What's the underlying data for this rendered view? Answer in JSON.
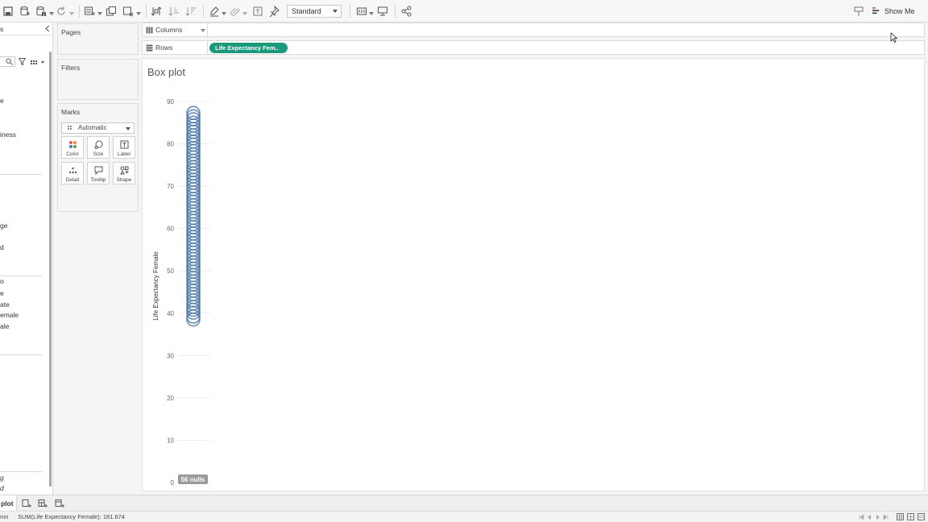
{
  "toolbar": {
    "fit_value": "Standard",
    "show_me_label": "Show Me",
    "icons": [
      "save-icon",
      "new-data-source-icon",
      "pause-icon",
      "refresh-icon",
      "new-worksheet-icon",
      "duplicate-icon",
      "clear-icon",
      "swap-icon",
      "sort-ascending-icon",
      "sort-descending-icon",
      "highlight-icon",
      "group-icon",
      "labels-icon",
      "pin-icon",
      "fit-icon",
      "presentation-icon",
      "share-icon"
    ]
  },
  "data_pane": {
    "header_fragment": "s",
    "field_fragments": [
      "e",
      "iness",
      "ge",
      "d",
      "o",
      "e",
      "ate",
      "emale",
      "ale"
    ],
    "bottom_fragments": [
      "g",
      "d"
    ]
  },
  "cards": {
    "pages_title": "Pages",
    "filters_title": "Filters",
    "marks_title": "Marks",
    "mark_type": "Automatic",
    "mark_buttons": [
      "Color",
      "Size",
      "Label",
      "Detail",
      "Tooltip",
      "Shape"
    ]
  },
  "shelves": {
    "columns_label": "Columns",
    "rows_label": "Rows",
    "rows_pill": "Life Expectancy Fem.."
  },
  "view": {
    "sheet_title": "Box plot"
  },
  "chart_data": {
    "type": "scatter",
    "ylabel": "Life Expectancy Female",
    "ylim": [
      0,
      90
    ],
    "yticks": [
      0,
      10,
      20,
      30,
      40,
      50,
      60,
      70,
      80,
      90
    ],
    "mark_color": "#4e79a7",
    "null_indicator": "56 nulls",
    "y_values": [
      38.5,
      39.2,
      40.1,
      40.8,
      41.5,
      42.3,
      43.0,
      43.8,
      44.5,
      45.3,
      46.0,
      46.8,
      47.5,
      48.3,
      49.0,
      49.8,
      50.5,
      51.3,
      52.0,
      52.8,
      53.5,
      54.3,
      55.0,
      55.8,
      56.5,
      57.3,
      58.0,
      58.8,
      59.5,
      60.3,
      61.0,
      61.8,
      62.5,
      63.3,
      64.0,
      64.8,
      65.5,
      66.3,
      67.0,
      67.8,
      68.5,
      69.3,
      70.0,
      70.8,
      71.5,
      72.3,
      73.0,
      73.8,
      74.5,
      75.3,
      76.0,
      76.8,
      77.5,
      78.3,
      79.0,
      79.8,
      80.5,
      81.3,
      82.0,
      82.8,
      83.5,
      84.3,
      85.0,
      85.8,
      86.5,
      87.3
    ]
  },
  "sheet_tabs": {
    "active_tab": "plot",
    "tab_icons": [
      "new-worksheet-icon",
      "new-dashboard-icon",
      "new-story-icon"
    ]
  },
  "status_bar": {
    "left_fragment": "mn",
    "text": "SUM(Life Expectancy Female): 181.674"
  }
}
